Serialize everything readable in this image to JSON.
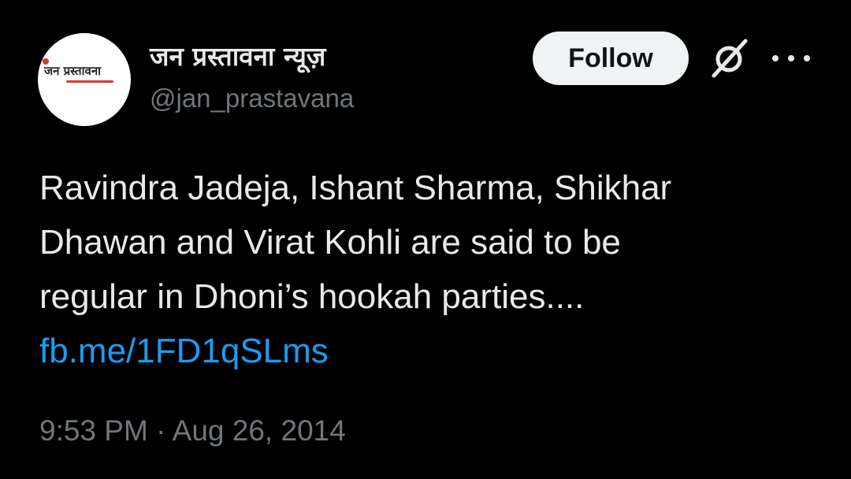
{
  "author": {
    "display_name": "जन प्रस्तावना न्यूज़",
    "handle": "@jan_prastavana",
    "avatar_logo_text": "जन प्रस्तावना"
  },
  "actions": {
    "follow_label": "Follow",
    "grok_icon": "grok-icon",
    "more_icon": "more-icon"
  },
  "tweet": {
    "lines": [
      "Ravindra Jadeja, Ishant Sharma, Shikhar",
      "Dhawan and Virat Kohli are said to be",
      "regular in Dhoni’s hookah parties...."
    ],
    "link": "fb.me/1FD1qSLms"
  },
  "meta": {
    "time": "9:53 PM",
    "separator": "·",
    "date": "Aug 26, 2014"
  },
  "colors": {
    "background": "#000000",
    "text": "#e7e9ea",
    "secondary_text": "#71767b",
    "link": "#1d9bf0",
    "follow_button_bg": "#eff3f4",
    "follow_button_text": "#0f1419"
  }
}
